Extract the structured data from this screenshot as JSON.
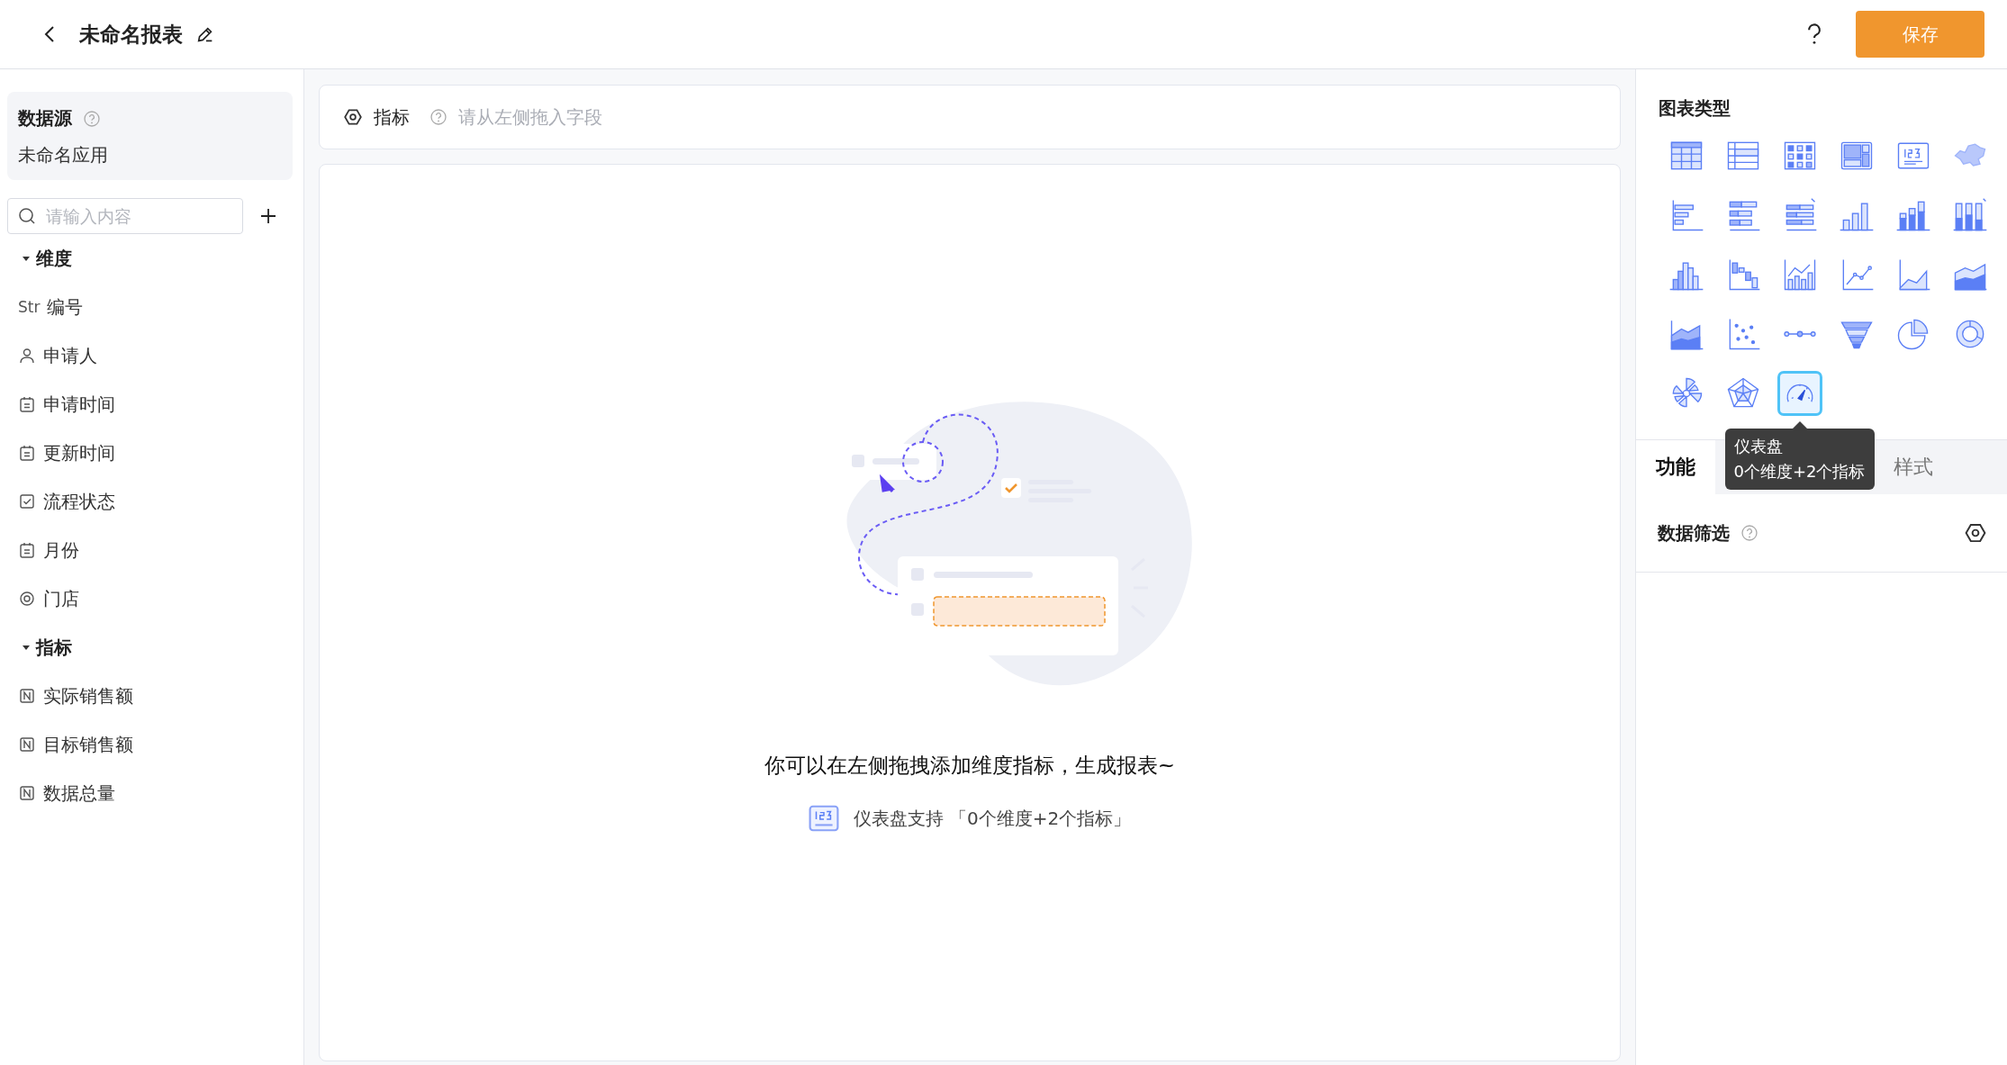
{
  "header": {
    "title": "未命名报表",
    "save": "保存"
  },
  "datasource": {
    "label": "数据源",
    "value": "未命名应用"
  },
  "search": {
    "placeholder": "请输入内容"
  },
  "groups": [
    {
      "label": "维度",
      "expanded": true,
      "fields": [
        {
          "kind": "str",
          "tag": "Str",
          "name": "编号"
        },
        {
          "kind": "user",
          "name": "申请人"
        },
        {
          "kind": "date",
          "name": "申请时间"
        },
        {
          "kind": "date",
          "name": "更新时间"
        },
        {
          "kind": "check",
          "name": "流程状态"
        },
        {
          "kind": "date",
          "name": "月份"
        },
        {
          "kind": "location",
          "name": "门店"
        }
      ]
    },
    {
      "label": "指标",
      "expanded": true,
      "fields": [
        {
          "kind": "number",
          "name": "实际销售额"
        },
        {
          "kind": "number",
          "name": "目标销售额"
        },
        {
          "kind": "number",
          "name": "数据总量"
        }
      ]
    }
  ],
  "metric_bar": {
    "label": "指标",
    "hint": "请从左侧拖入字段"
  },
  "empty": {
    "message": "你可以在左侧拖拽添加维度指标，生成报表~",
    "support": "仪表盘支持 「0个维度+2个指标」"
  },
  "chart_panel": {
    "title": "图表类型",
    "types": [
      {
        "kind": "table",
        "selected": false
      },
      {
        "kind": "list",
        "selected": false
      },
      {
        "kind": "heatgrid",
        "selected": false
      },
      {
        "kind": "layout",
        "selected": false
      },
      {
        "kind": "number",
        "selected": false
      },
      {
        "kind": "map",
        "selected": false
      },
      {
        "kind": "hbar",
        "selected": false
      },
      {
        "kind": "hbar-stacked",
        "selected": false
      },
      {
        "kind": "hbar-percent",
        "selected": false
      },
      {
        "kind": "bar",
        "selected": false
      },
      {
        "kind": "bar-stacked",
        "selected": false
      },
      {
        "kind": "bar-percent",
        "selected": false
      },
      {
        "kind": "histogram",
        "selected": false
      },
      {
        "kind": "waterfall",
        "selected": false
      },
      {
        "kind": "combo",
        "selected": false
      },
      {
        "kind": "line",
        "selected": false
      },
      {
        "kind": "area",
        "selected": false
      },
      {
        "kind": "area-stacked",
        "selected": false
      },
      {
        "kind": "area-percent",
        "selected": false
      },
      {
        "kind": "scatter",
        "selected": false
      },
      {
        "kind": "dots-line",
        "selected": false
      },
      {
        "kind": "funnel",
        "selected": false
      },
      {
        "kind": "pie",
        "selected": false
      },
      {
        "kind": "donut",
        "selected": false
      },
      {
        "kind": "rose",
        "selected": false
      },
      {
        "kind": "radar",
        "selected": false
      },
      {
        "kind": "gauge",
        "selected": true
      }
    ]
  },
  "tooltip": {
    "title": "仪表盘",
    "subtitle": "0个维度+2个指标"
  },
  "tabs": [
    {
      "label": "功能",
      "selected": true
    },
    {
      "label": "样式",
      "selected": false
    }
  ],
  "filter": {
    "label": "数据筛选"
  }
}
